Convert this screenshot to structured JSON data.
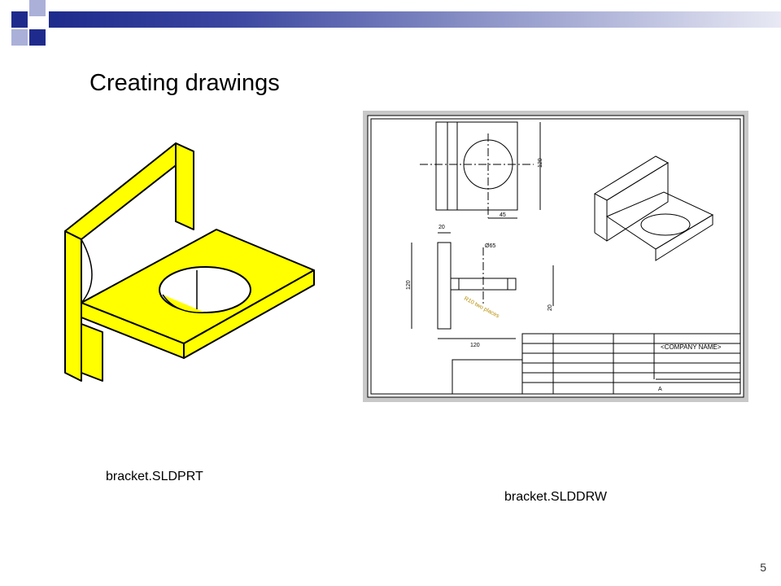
{
  "slide": {
    "title": "Creating drawings",
    "page_number": "5"
  },
  "part": {
    "caption": "bracket.SLDPRT",
    "color": "#ffff00"
  },
  "drawing": {
    "caption": "bracket.SLDDRW",
    "company_name": "<COMPANY NAME>",
    "dim_120_top": "120",
    "dim_45": "45",
    "dim_20_top": "20",
    "dim_phi65": "Ø65",
    "dim_120_side": "120",
    "dim_120_bottom": "120",
    "dim_20_right": "20",
    "fillet_note": "R10 two places",
    "sheet_size": "A"
  },
  "colors": {
    "header_dark": "#1f2b8c",
    "header_mid": "#8e95c8",
    "accent_blue": "#1f2b8c",
    "accent_light": "#aab0d8"
  }
}
